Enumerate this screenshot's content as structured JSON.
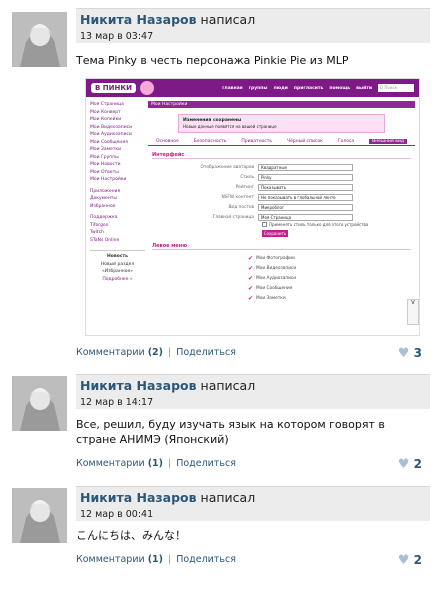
{
  "posts": [
    {
      "author": "Никита Назаров",
      "action": "написал",
      "date": "13 мар в 03:47",
      "text": "Тема Pinky в честь персонажа Pinkie Pie из MLP",
      "comments_label": "Комментарии",
      "comments_count": "(2)",
      "share_label": "Поделиться",
      "likes": "3"
    },
    {
      "author": "Никита Назаров",
      "action": "написал",
      "date": "12 мар в 14:17",
      "text": "Все, решил, буду изучать язык на котором говорят в стране АНИМЭ (Японский)",
      "comments_label": "Комментарии",
      "comments_count": "(1)",
      "share_label": "Поделиться",
      "likes": "2"
    },
    {
      "author": "Никита Назаров",
      "action": "написал",
      "date": "12 мар в 00:41",
      "text": "こんにちは、みんな！",
      "comments_label": "Комментарии",
      "comments_count": "(1)",
      "share_label": "Поделиться",
      "likes": "2"
    }
  ],
  "shot": {
    "logo": "В ПИНКИ",
    "nav": [
      "главная",
      "группы",
      "люди",
      "пригласить",
      "помощь",
      "выйти"
    ],
    "search": "Q Поиск",
    "left_menu": [
      "Моя Страница",
      "Мои Конверт",
      "Мои Копейки",
      "Мои Видеозаписи",
      "Мои Аудиозаписи",
      "Мои Сообщения",
      "Мои Заметки",
      "Мои Группы",
      "Мои Новости",
      "Мои Ответы",
      "Мои Настройки",
      "Приложения",
      "Документы",
      "Избранное",
      "Поддержка",
      "Tiforgon",
      "Twitch",
      "STaNs Online"
    ],
    "news_title": "Новость",
    "news_text": "Новый раздел «Избранное»",
    "news_more": "Подробнее »",
    "title": "Мои Настройки",
    "notice_title": "Изменения сохранены",
    "notice_text": "Новые данные появятся на вашей странице",
    "tabs": [
      "Основное",
      "Безопасность",
      "Приватность",
      "Чёрный список",
      "Голоса",
      "Внешний вид"
    ],
    "section_interface": "Интерфейс",
    "rows": [
      {
        "label": "Отображение аватаров",
        "value": "Квадратные"
      },
      {
        "label": "Стиль",
        "value": "Pinky"
      },
      {
        "label": "Рейтинг",
        "value": "Показывать"
      },
      {
        "label": "NSFW контент",
        "value": "Не показывать в глобальной ленте"
      },
      {
        "label": "Вид постов",
        "value": "Микроблог"
      },
      {
        "label": "Главная страница",
        "value": "Моя Страница"
      }
    ],
    "apply_text": "Применять стиль только для этого устройства",
    "save": "Сохранить",
    "section_menu": "Левое меню",
    "menu_checks": [
      "Мои Фотографии",
      "Мои Видеозаписи",
      "Мои Аудиозаписи",
      "Мои Сообщения",
      "Мои Заметки"
    ],
    "side_letter": "V"
  }
}
